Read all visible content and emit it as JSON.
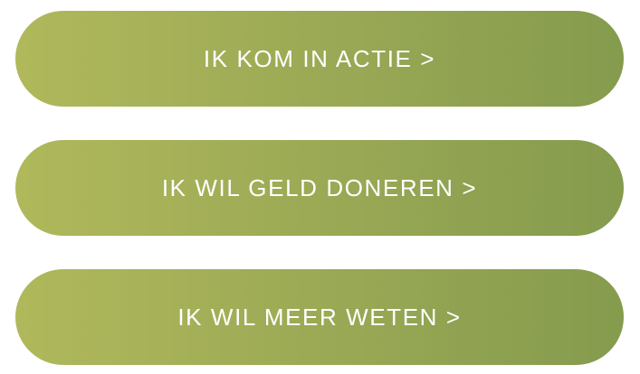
{
  "buttons": [
    {
      "label": "IK KOM IN ACTIE >"
    },
    {
      "label": "IK WIL GELD DONEREN >"
    },
    {
      "label": "IK WIL MEER WETEN >"
    }
  ],
  "colors": {
    "gradient_start": "#b0b85b",
    "gradient_end": "#859b4d",
    "text": "#ffffff",
    "background": "#ffffff"
  }
}
